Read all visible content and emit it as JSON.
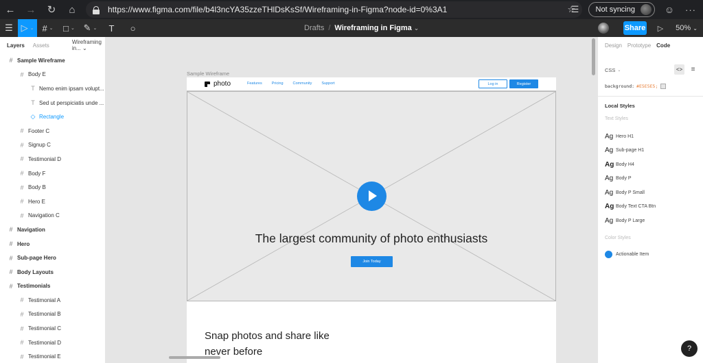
{
  "browser": {
    "url": "https://www.figma.com/file/b4l3ncYA35zzeTHlDsKsSf/Wireframing-in-Figma?node-id=0%3A1",
    "sync_label": "Not syncing",
    "nav_icons": [
      "back-arrow-icon",
      "forward-arrow-icon",
      "refresh-icon",
      "home-icon"
    ]
  },
  "toolbar": {
    "breadcrumb_root": "Drafts",
    "breadcrumb_sep": "/",
    "file_name": "Wireframing in Figma",
    "file_caret": "⌄",
    "share_label": "Share",
    "zoom": "50%",
    "zoom_caret": "⌄",
    "accent_color": "#0d99ff"
  },
  "layers_panel": {
    "tab_layers": "Layers",
    "tab_assets": "Assets",
    "page_name": "Wireframing in...",
    "items": [
      {
        "label": "Sample Wireframe",
        "level": "top",
        "icon": "#"
      },
      {
        "label": "Body E",
        "level": "l1",
        "icon": "#"
      },
      {
        "label": "Nemo enim ipsam volupt...",
        "level": "l2",
        "icon": "T"
      },
      {
        "label": "Sed ut perspiciatis unde ...",
        "level": "l2",
        "icon": "T"
      },
      {
        "label": "Rectangle",
        "level": "l2",
        "icon": "◇",
        "selected": true
      },
      {
        "label": "Footer C",
        "level": "l1",
        "icon": "#"
      },
      {
        "label": "Signup C",
        "level": "l1",
        "icon": "#"
      },
      {
        "label": "Testimonial D",
        "level": "l1",
        "icon": "#"
      },
      {
        "label": "Body F",
        "level": "l1",
        "icon": "#"
      },
      {
        "label": "Body B",
        "level": "l1",
        "icon": "#"
      },
      {
        "label": "Hero E",
        "level": "l1",
        "icon": "#"
      },
      {
        "label": "Navigation C",
        "level": "l1",
        "icon": "#"
      },
      {
        "label": "Navigation",
        "level": "top",
        "icon": "#"
      },
      {
        "label": "Hero",
        "level": "top",
        "icon": "#"
      },
      {
        "label": "Sub-page Hero",
        "level": "top",
        "icon": "#"
      },
      {
        "label": "Body Layouts",
        "level": "top",
        "icon": "#"
      },
      {
        "label": "Testimonials",
        "level": "top",
        "icon": "#"
      },
      {
        "label": "Testimonial A",
        "level": "l1",
        "icon": "#"
      },
      {
        "label": "Testimonial B",
        "level": "l1",
        "icon": "#"
      },
      {
        "label": "Testimonial C",
        "level": "l1",
        "icon": "#"
      },
      {
        "label": "Testimonial D",
        "level": "l1",
        "icon": "#"
      },
      {
        "label": "Testimonial E",
        "level": "l1",
        "icon": "#"
      }
    ]
  },
  "canvas": {
    "frame_label": "Sample Wireframe",
    "wireframe": {
      "logo": "photo",
      "nav_links": [
        "Features",
        "Pricing",
        "Community",
        "Support"
      ],
      "login": "Log in",
      "register": "Register",
      "hero_heading": "The largest community of photo enthusiasts",
      "cta": "Join Today",
      "snap_line1": "Snap photos and share like",
      "snap_line2": "never before"
    }
  },
  "inspect_panel": {
    "tabs": [
      "Design",
      "Prototype",
      "Code"
    ],
    "active_tab": "Code",
    "language": "CSS",
    "code_prop": "background:",
    "code_value": "#E5E5E5;",
    "local_styles_title": "Local Styles",
    "text_styles_title": "Text Styles",
    "text_styles": [
      {
        "label": "Hero H1",
        "bold": false
      },
      {
        "label": "Sub-page H1",
        "bold": false
      },
      {
        "label": "Body H4",
        "bold": true
      },
      {
        "label": "Body P",
        "bold": false
      },
      {
        "label": "Body P Small",
        "bold": false
      },
      {
        "label": "Body Text CTA Btn",
        "bold": true
      },
      {
        "label": "Body P Large",
        "bold": false
      }
    ],
    "color_styles_title": "Color Styles",
    "color_style": "Actionable Item",
    "color_style_hex": "#1e88e5",
    "help": "?"
  }
}
